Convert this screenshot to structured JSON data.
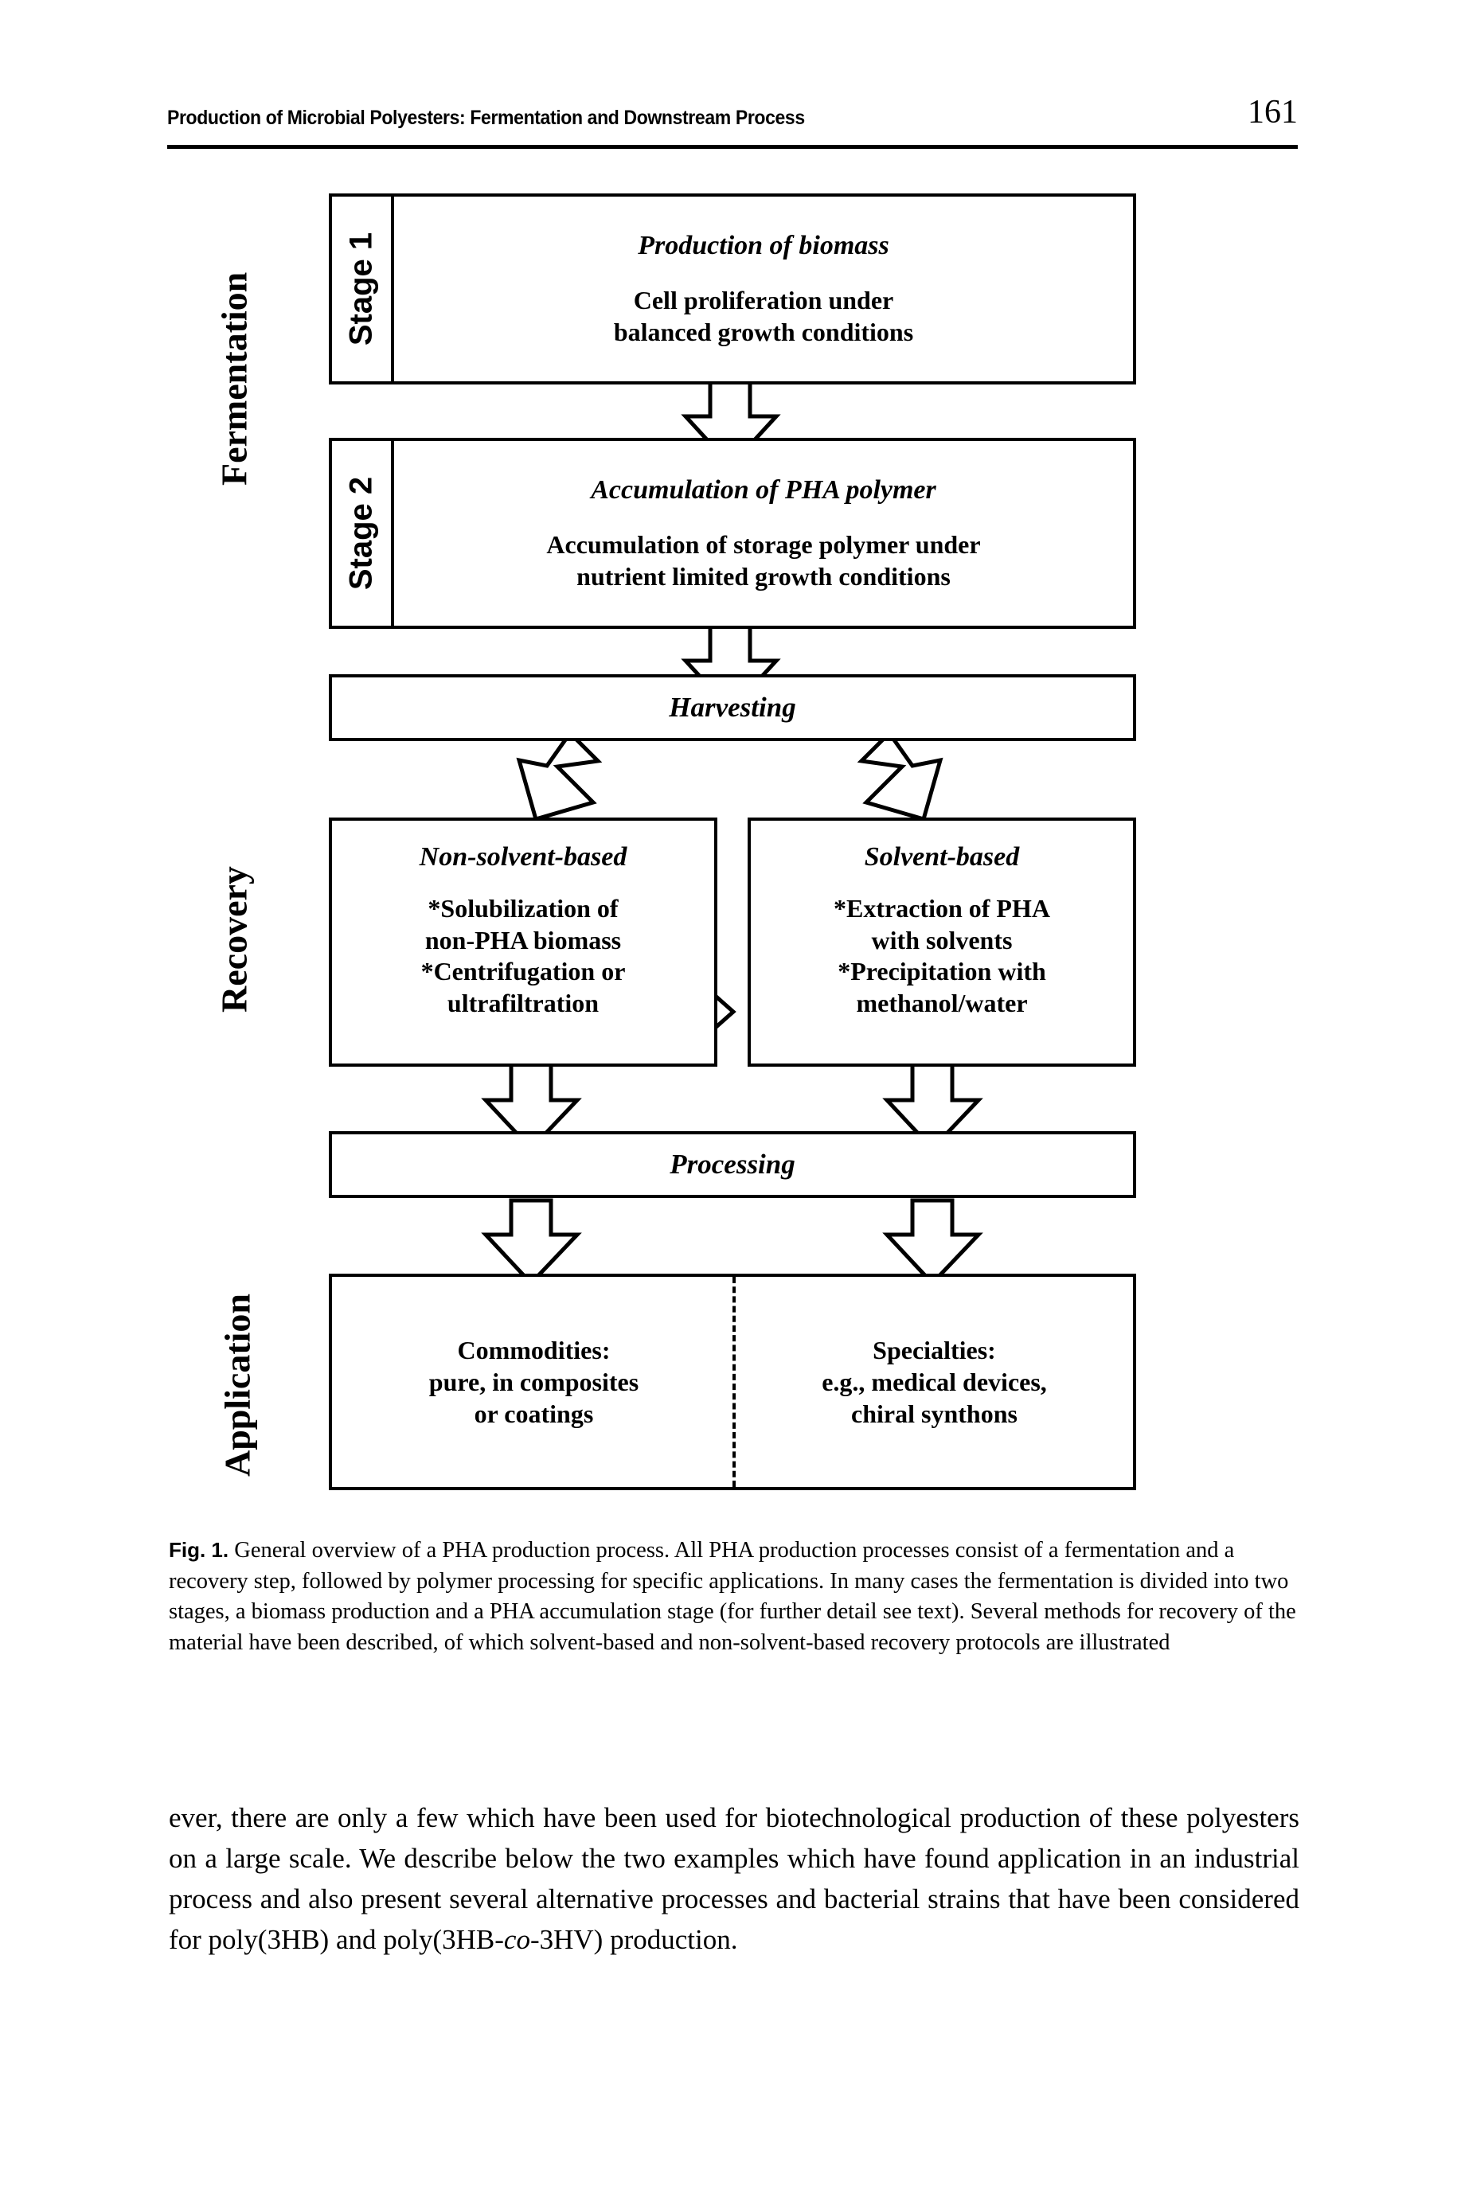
{
  "page": {
    "running_head": "Production of Microbial Polyesters: Fermentation and Downstream Process",
    "page_number": "161"
  },
  "figure": {
    "side_labels": {
      "fermentation": "Fermentation",
      "recovery": "Recovery",
      "application": "Application"
    },
    "stage1": {
      "tab": "Stage 1",
      "title": "Production of biomass",
      "line1": "Cell proliferation under",
      "line2": "balanced growth conditions"
    },
    "stage2": {
      "tab": "Stage 2",
      "title": "Accumulation of PHA polymer",
      "line1": "Accumulation of storage polymer under",
      "line2": "nutrient limited growth conditions"
    },
    "harvesting": {
      "title": "Harvesting"
    },
    "non_solvent": {
      "title": "Non-solvent-based",
      "line1": "*Solubilization of",
      "line2": "non-PHA biomass",
      "line3": "*Centrifugation or",
      "line4": "ultrafiltration"
    },
    "solvent": {
      "title": "Solvent-based",
      "line1": "*Extraction of PHA",
      "line2": "with solvents",
      "line3": "*Precipitation with",
      "line4": "methanol/water"
    },
    "processing": {
      "title": "Processing"
    },
    "application": {
      "commodities_line1": "Commodities:",
      "commodities_line2": "pure, in composites",
      "commodities_line3": "or coatings",
      "specialties_line1": "Specialties:",
      "specialties_line2": "e.g., medical devices,",
      "specialties_line3": "chiral synthons"
    }
  },
  "caption": {
    "label": "Fig. 1.",
    "text": "General overview of a PHA production process. All PHA production processes consist of a fermentation and a recovery step, followed by polymer processing for specific applications. In many cases the fermentation is divided into two stages, a biomass production and a PHA accumulation stage (for further detail see text). Several methods for recovery of the material have been described, of which solvent-based and non-solvent-based recovery protocols are illustrated"
  },
  "body": {
    "part1": "ever, there are only a few which have been used for biotechnological production of these polyesters on a large scale. We describe below the two examples which have found application in an industrial process and also present several alternative processes and bacterial strains that have been considered for poly(3HB) and poly(3HB-",
    "italic": "co",
    "part2": "-3HV) production."
  },
  "colors": {
    "ink": "#000000",
    "paper": "#ffffff"
  }
}
